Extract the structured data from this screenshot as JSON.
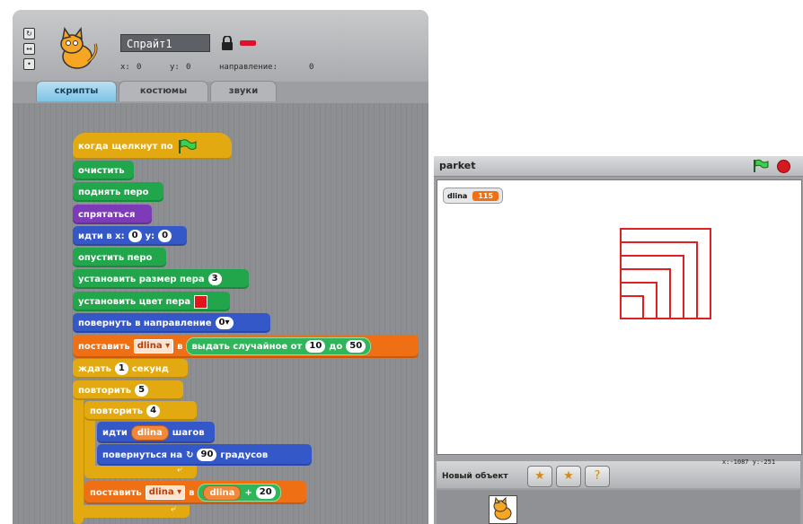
{
  "sprite_header": {
    "name": "Спрайт1",
    "x_label": "x:",
    "x_value": "0",
    "y_label": "y:",
    "y_value": "0",
    "direction_label": "направление:",
    "direction_value": "0"
  },
  "tabs": [
    {
      "label": "скрипты",
      "active": true
    },
    {
      "label": "костюмы",
      "active": false
    },
    {
      "label": "звуки",
      "active": false
    }
  ],
  "script": {
    "hat": "когда щелкнут по",
    "clear": "очистить",
    "pen_up": "поднять перо",
    "hide": "спрятаться",
    "goto_label": "идти в x:",
    "goto_x": "0",
    "goto_y_label": "y:",
    "goto_y": "0",
    "pen_down": "опустить перо",
    "pen_size_label": "установить размер пера",
    "pen_size": "3",
    "pen_color_label": "установить цвет пера",
    "point_dir_label": "повернуть в направление",
    "point_dir_value": "0",
    "set_label": "поставить",
    "set_var": "dlina",
    "set_to": "в",
    "random_label": "выдать случайное от",
    "random_from": "10",
    "random_to_label": "до",
    "random_to": "50",
    "wait_label": "ждать",
    "wait_value": "1",
    "wait_unit": "секунд",
    "repeat_outer_label": "повторить",
    "repeat_outer_value": "5",
    "repeat_inner_label": "повторить",
    "repeat_inner_value": "4",
    "move_label": "идти",
    "move_var": "dlina",
    "move_unit": "шагов",
    "turn_label": "повернуться на",
    "turn_value": "90",
    "turn_unit": "градусов",
    "set2_label": "поставить",
    "set2_var": "dlina",
    "set2_to": "в",
    "add_var": "dlina",
    "add_op": "+",
    "add_value": "20"
  },
  "stage": {
    "title": "parket",
    "monitor_label": "dlina",
    "monitor_value": "115",
    "mouse_x_label": "x:",
    "mouse_x": "-1087",
    "mouse_y_label": "y:",
    "mouse_y": "-251",
    "drawing_color": "#e02020"
  },
  "sprite_bar": {
    "new_object_label": "Новый объект"
  },
  "colors": {
    "motion": "#3558c8",
    "pen": "#21a64c",
    "looks": "#7d3bb7",
    "variables": "#ef6f14",
    "control": "#e2a911",
    "operators": "#2fb55a"
  }
}
